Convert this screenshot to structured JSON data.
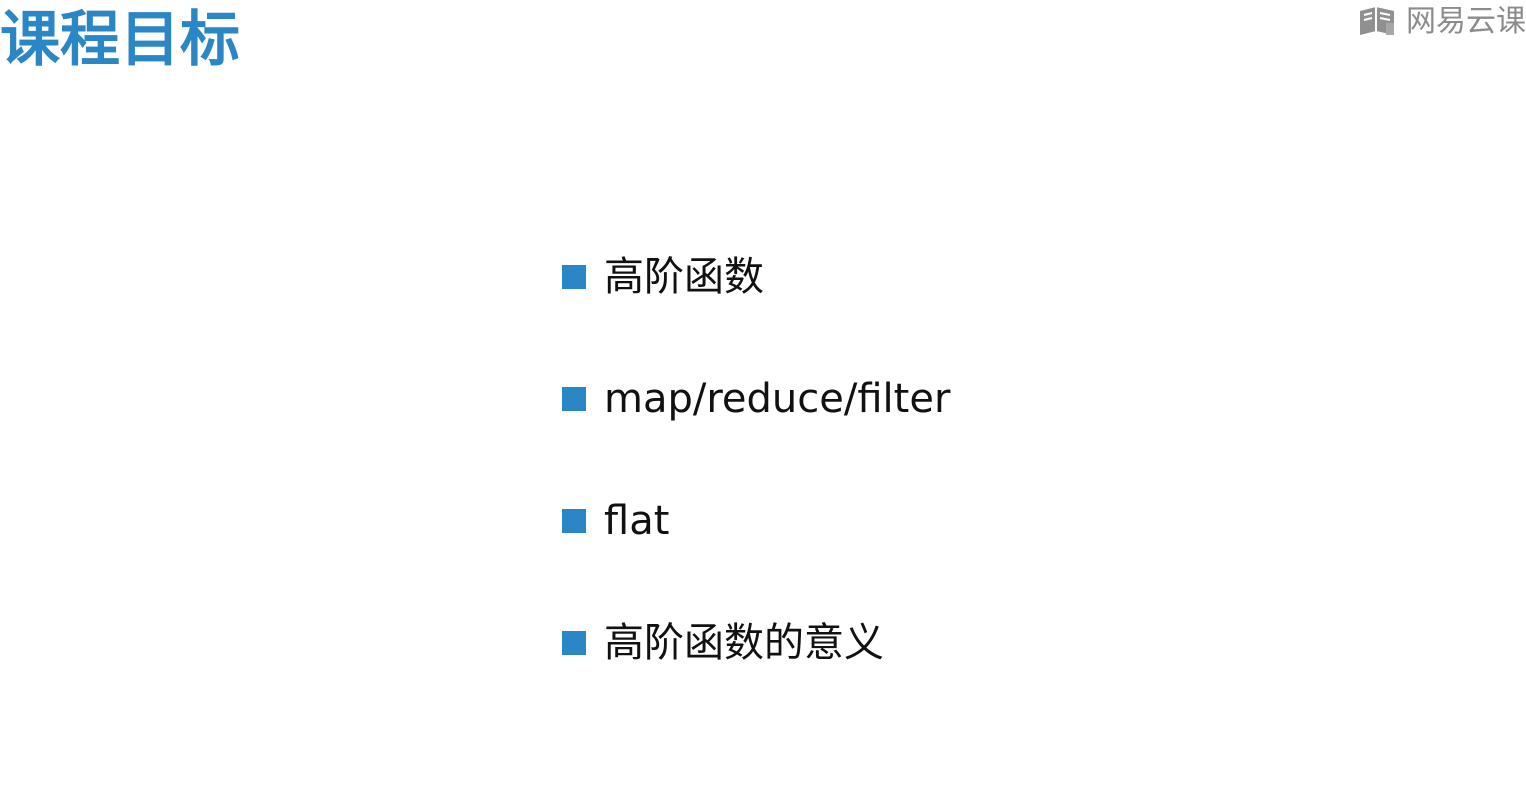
{
  "slide": {
    "title": "课程目标",
    "watermark": "网易云课",
    "bullets": [
      {
        "text": "高阶函数"
      },
      {
        "text": "map/reduce/filter"
      },
      {
        "text": "flat"
      },
      {
        "text": "高阶函数的意义"
      }
    ]
  },
  "colors": {
    "accent": "#2b86c5",
    "text": "#111111",
    "watermark": "#666666",
    "background": "#ffffff"
  },
  "icons": {
    "watermark_logo": "book-icon",
    "bullet_marker": "square-bullet-icon"
  }
}
